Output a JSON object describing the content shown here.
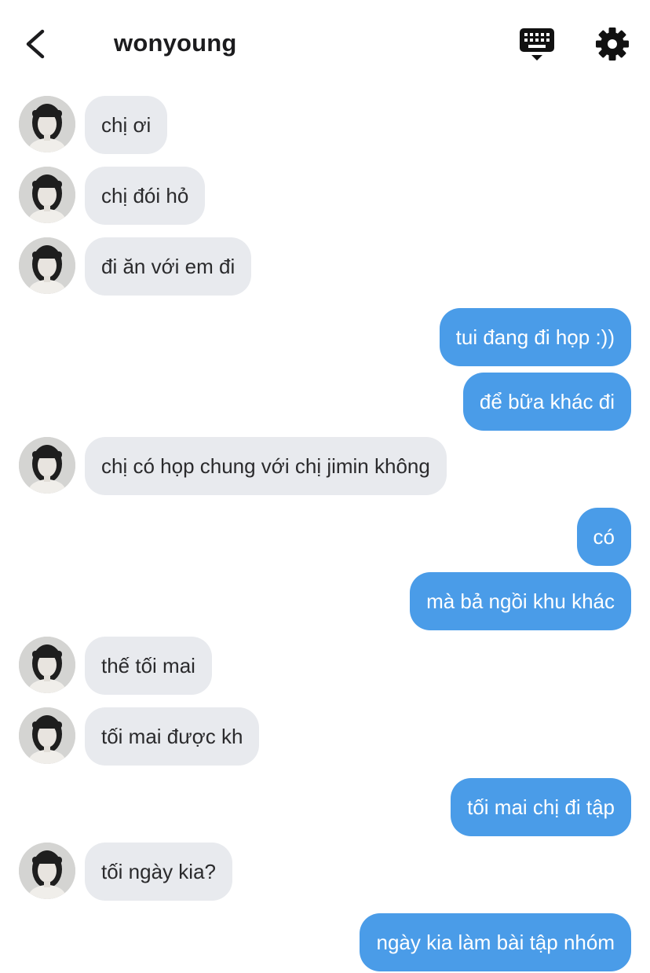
{
  "header": {
    "title": "wonyoung",
    "back_icon": "chevron-left-icon",
    "keyboard_icon": "keyboard-icon",
    "settings_icon": "gear-icon"
  },
  "colors": {
    "incoming_bubble": "#e8eaee",
    "outgoing_bubble": "#4a9ce8",
    "outgoing_text": "#ffffff",
    "incoming_text": "#2a2a2c"
  },
  "messages": [
    {
      "from": "them",
      "text": "chị ơi"
    },
    {
      "from": "them",
      "text": "chị đói hỏ"
    },
    {
      "from": "them",
      "text": "đi ăn với em đi"
    },
    {
      "from": "me",
      "text": "tui đang đi họp :))"
    },
    {
      "from": "me",
      "text": "để bữa khác đi"
    },
    {
      "from": "them",
      "text": "chị có họp chung với chị jimin không"
    },
    {
      "from": "me",
      "text": "có"
    },
    {
      "from": "me",
      "text": "mà bả ngồi khu khác"
    },
    {
      "from": "them",
      "text": "thế tối mai"
    },
    {
      "from": "them",
      "text": "tối mai được kh"
    },
    {
      "from": "me",
      "text": "tối mai chị đi tập"
    },
    {
      "from": "them",
      "text": "tối ngày kia?"
    },
    {
      "from": "me",
      "text": "ngày kia làm bài tập nhóm"
    }
  ]
}
